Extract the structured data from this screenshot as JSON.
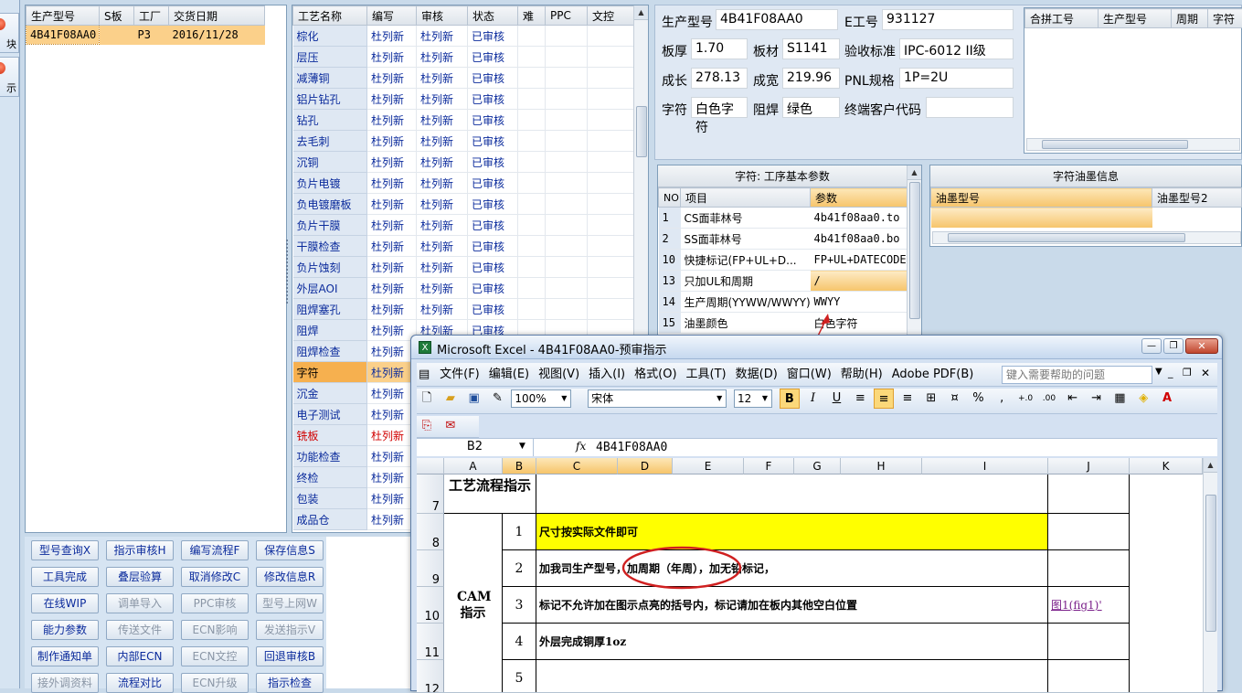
{
  "left_strip": {
    "btn1": "块",
    "btn2": "示"
  },
  "model_list": {
    "headers": [
      "生产型号",
      "S板",
      "工厂",
      "交货日期"
    ],
    "rows": [
      [
        "4B41F08AA0",
        "",
        "P3",
        "2016/11/28"
      ]
    ]
  },
  "process_list": {
    "headers": [
      "工艺名称",
      "编写",
      "审核",
      "状态",
      "难",
      "PPC",
      "文控"
    ],
    "rows": [
      [
        "棕化",
        "杜列新",
        "杜列新",
        "已审核"
      ],
      [
        "层压",
        "杜列新",
        "杜列新",
        "已审核"
      ],
      [
        "减薄铜",
        "杜列新",
        "杜列新",
        "已审核"
      ],
      [
        "铝片钻孔",
        "杜列新",
        "杜列新",
        "已审核"
      ],
      [
        "钻孔",
        "杜列新",
        "杜列新",
        "已审核"
      ],
      [
        "去毛刺",
        "杜列新",
        "杜列新",
        "已审核"
      ],
      [
        "沉铜",
        "杜列新",
        "杜列新",
        "已审核"
      ],
      [
        "负片电镀",
        "杜列新",
        "杜列新",
        "已审核"
      ],
      [
        "负电镀磨板",
        "杜列新",
        "杜列新",
        "已审核"
      ],
      [
        "负片干膜",
        "杜列新",
        "杜列新",
        "已审核"
      ],
      [
        "干膜检查",
        "杜列新",
        "杜列新",
        "已审核"
      ],
      [
        "负片蚀刻",
        "杜列新",
        "杜列新",
        "已审核"
      ],
      [
        "外层AOI",
        "杜列新",
        "杜列新",
        "已审核"
      ],
      [
        "阻焊塞孔",
        "杜列新",
        "杜列新",
        "已审核"
      ],
      [
        "阻焊",
        "杜列新",
        "杜列新",
        "已审核"
      ],
      [
        "阻焊检查",
        "杜列新",
        "",
        ""
      ],
      [
        "字符",
        "杜列新",
        "",
        ""
      ],
      [
        "沉金",
        "杜列新",
        "",
        ""
      ],
      [
        "电子测试",
        "杜列新",
        "",
        ""
      ],
      [
        "铣板",
        "杜列新",
        "",
        ""
      ],
      [
        "功能检查",
        "杜列新",
        "",
        ""
      ],
      [
        "终检",
        "杜列新",
        "",
        ""
      ],
      [
        "包装",
        "杜列新",
        "",
        ""
      ],
      [
        "成品仓",
        "杜列新",
        "",
        ""
      ]
    ]
  },
  "info": {
    "model_label": "生产型号",
    "model": "4B41F08AA0",
    "e_label": "E工号",
    "e": "931127",
    "thick_label": "板厚",
    "thick": "1.70",
    "mat_label": "板材",
    "mat": "S1141",
    "std_label": "验收标准",
    "std": "IPC-6012 II级",
    "len_label": "成长",
    "len": "278.13",
    "wid_label": "成宽",
    "wid": "219.96",
    "pnl_label": "PNL规格",
    "pnl": "1P=2U",
    "char_label": "字符",
    "char": "白色字符",
    "mask_label": "阻焊",
    "mask": "绿色",
    "cust_label": "终端客户代码",
    "cust": ""
  },
  "merge_table": {
    "headers": [
      "合拼工号",
      "生产型号",
      "周期",
      "字符"
    ]
  },
  "params": {
    "title": "字符: 工序基本参数",
    "headers": [
      "NO",
      "项目",
      "参数"
    ],
    "rows": [
      [
        "1",
        "CS面菲林号",
        "4b41f08aa0.to"
      ],
      [
        "2",
        "SS面菲林号",
        "4b41f08aa0.bo"
      ],
      [
        "10",
        "快捷标记(FP+UL+D...",
        "FP+UL+DATECODE"
      ],
      [
        "13",
        "只加UL和周期",
        "/"
      ],
      [
        "14",
        "生产周期(YYWW/WWYY)",
        "WWYY"
      ],
      [
        "15",
        "油墨颜色",
        "白色字符"
      ]
    ]
  },
  "ink": {
    "title": "字符油墨信息",
    "headers": [
      "油墨型号",
      "油墨型号2"
    ]
  },
  "buttons": [
    [
      {
        "label": "型号查询X",
        "dis": false
      },
      {
        "label": "指示审核H",
        "dis": false
      },
      {
        "label": "编写流程F",
        "dis": false
      },
      {
        "label": "保存信息S",
        "dis": false
      }
    ],
    [
      {
        "label": "工具完成",
        "dis": false
      },
      {
        "label": "叠层验算",
        "dis": false
      },
      {
        "label": "取消修改C",
        "dis": false
      },
      {
        "label": "修改信息R",
        "dis": false
      }
    ],
    [
      {
        "label": "在线WIP",
        "dis": false
      },
      {
        "label": "调单导入",
        "dis": true
      },
      {
        "label": "PPC审核",
        "dis": true
      },
      {
        "label": "型号上网W",
        "dis": true
      }
    ],
    [
      {
        "label": "能力参数",
        "dis": false
      },
      {
        "label": "传送文件",
        "dis": true
      },
      {
        "label": "ECN影响",
        "dis": true
      },
      {
        "label": "发送指示V",
        "dis": true
      }
    ],
    [
      {
        "label": "制作通知单",
        "dis": false
      },
      {
        "label": "内部ECN",
        "dis": false
      },
      {
        "label": "ECN文控",
        "dis": true
      },
      {
        "label": "回退审核B",
        "dis": false
      }
    ],
    [
      {
        "label": "接外调资料",
        "dis": true
      },
      {
        "label": "流程对比",
        "dis": false
      },
      {
        "label": "ECN升级",
        "dis": true
      },
      {
        "label": "指示检查",
        "dis": false
      }
    ]
  ],
  "excel": {
    "title": "Microsoft Excel - 4B41F08AA0-预审指示",
    "menus": [
      "文件(F)",
      "编辑(E)",
      "视图(V)",
      "插入(I)",
      "格式(O)",
      "工具(T)",
      "数据(D)",
      "窗口(W)",
      "帮助(H)",
      "Adobe PDF(B)"
    ],
    "help_placeholder": "键入需要帮助的问题",
    "zoom": "100%",
    "font": "宋体",
    "size": "12",
    "namebox": "B2",
    "formula": "4B41F08AA0",
    "fx": "fx",
    "cols": [
      "A",
      "B",
      "C",
      "D",
      "E",
      "F",
      "G",
      "H",
      "I",
      "J",
      "K"
    ],
    "row_nums": [
      "7",
      "8",
      "9",
      "10",
      "11",
      "12"
    ],
    "a7": "工艺流程指示",
    "cam": "CAM指示",
    "items": [
      {
        "n": "1",
        "text": "尺寸按实际文件即可"
      },
      {
        "n": "2",
        "text": "加我司生产型号，加周期（年周），加无铅标记，"
      },
      {
        "n": "3",
        "text": "标记不允许加在图示点亮的括号内，标记请加在板内其他空白位置"
      },
      {
        "n": "4",
        "text": "外层完成铜厚1oz"
      },
      {
        "n": "5",
        "text": ""
      }
    ],
    "link": "图1(fig1)'"
  }
}
